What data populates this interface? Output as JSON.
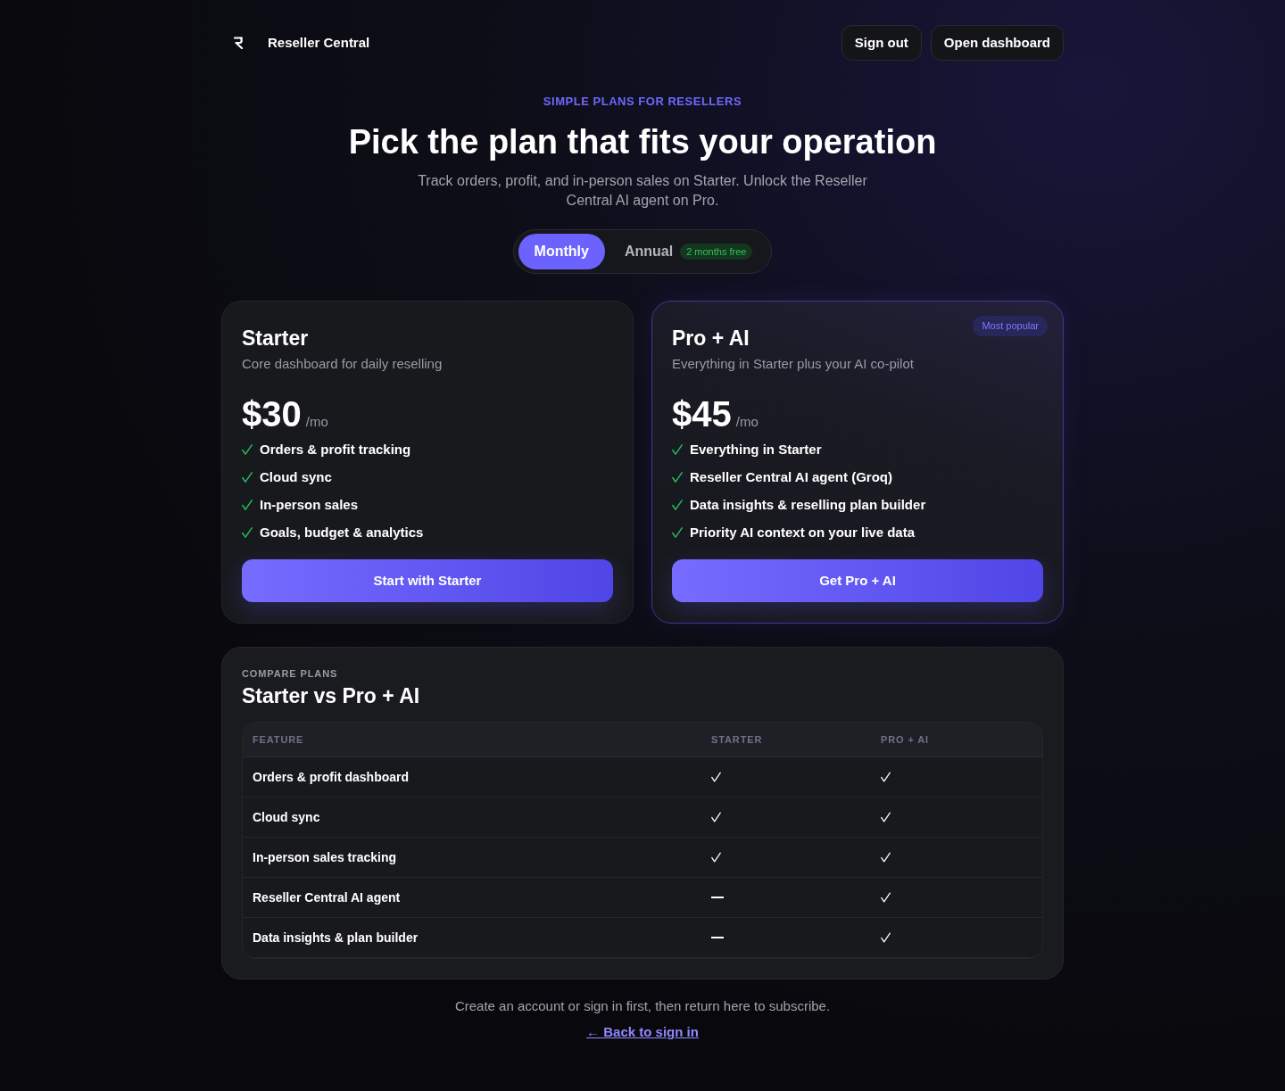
{
  "header": {
    "brand": "Reseller Central",
    "buttons": [
      "Sign out",
      "Open dashboard"
    ]
  },
  "hero": {
    "eyebrow": "SIMPLE PLANS FOR RESELLERS",
    "title": "Pick the plan that fits your operation",
    "subtitle": "Track orders, profit, and in-person sales on Starter. Unlock the Reseller Central AI agent on Pro."
  },
  "billing": {
    "options": [
      {
        "label": "Monthly",
        "selected": true
      },
      {
        "label": "Annual",
        "selected": false,
        "badge": "2 months free"
      }
    ]
  },
  "plans": [
    {
      "name": "Starter",
      "description": "Core dashboard for daily reselling",
      "price": "$30",
      "period": "/mo",
      "featured": false,
      "features": [
        "Orders & profit tracking",
        "Cloud sync",
        "In-person sales",
        "Goals, budget & analytics"
      ],
      "button": "Start with Starter"
    },
    {
      "name": "Pro + AI",
      "description": "Everything in Starter plus your AI co-pilot",
      "price": "$45",
      "period": "/mo",
      "featured": true,
      "badge": "Most popular",
      "features": [
        "Everything in Starter",
        "Reseller Central AI agent (Groq)",
        "Data insights & reselling plan builder",
        "Priority AI context on your live data"
      ],
      "button": "Get Pro + AI"
    }
  ],
  "comparison": {
    "eyebrow": "COMPARE PLANS",
    "title": "Starter vs Pro + AI",
    "columns": [
      "FEATURE",
      "STARTER",
      "PRO + AI"
    ],
    "rows": [
      {
        "feature": "Orders & profit dashboard",
        "starter": true,
        "pro": true
      },
      {
        "feature": "Cloud sync",
        "starter": true,
        "pro": true
      },
      {
        "feature": "In-person sales tracking",
        "starter": true,
        "pro": true
      },
      {
        "feature": "Reseller Central AI agent",
        "starter": false,
        "pro": true
      },
      {
        "feature": "Data insights & plan builder",
        "starter": false,
        "pro": true
      }
    ]
  },
  "footer": {
    "note": "Create an account or sign in first, then return here to subscribe.",
    "link": "← Back to sign in"
  }
}
